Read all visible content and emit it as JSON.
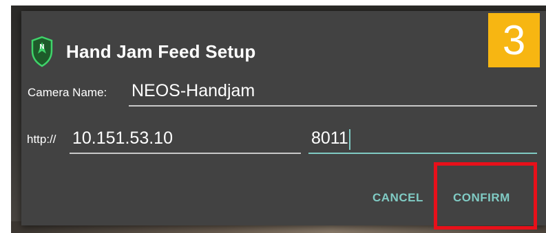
{
  "dialog": {
    "title": "Hand Jam Feed Setup",
    "icon": "shield-n-logo-icon",
    "accent_color": "#80cbc4",
    "background_color": "#424242"
  },
  "step_badge": {
    "number": "3",
    "color": "#f7b612"
  },
  "camera_name": {
    "label": "Camera Name:",
    "value": "NEOS-Handjam"
  },
  "url": {
    "prefix_label": "http://",
    "host_value": "10.151.53.10",
    "port_value": "8011"
  },
  "buttons": {
    "cancel_label": "CANCEL",
    "confirm_label": "CONFIRM"
  },
  "annotation": {
    "highlight_color": "#e8101a",
    "highlight_target": "confirm-button"
  }
}
